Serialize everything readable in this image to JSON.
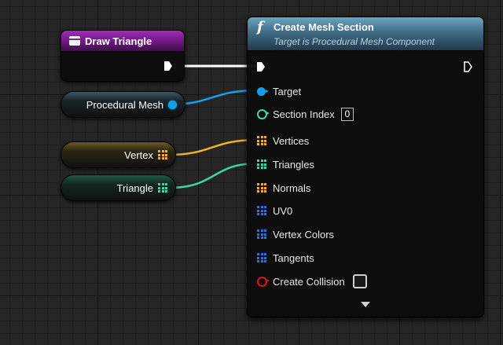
{
  "event_node": {
    "title": "Draw Triangle"
  },
  "variables": {
    "procedural_mesh": "Procedural Mesh",
    "vertex": "Vertex",
    "triangle": "Triangle"
  },
  "function_node": {
    "title": "Create Mesh Section",
    "subtitle": "Target is Procedural Mesh Component",
    "pins": {
      "target": "Target",
      "section_index": "Section Index",
      "section_index_value": "0",
      "vertices": "Vertices",
      "triangles": "Triangles",
      "normals": "Normals",
      "uv0": "UV0",
      "vertex_colors": "Vertex Colors",
      "tangents": "Tangents",
      "create_collision": "Create Collision"
    }
  },
  "colors": {
    "object_pin": "#14a0e8",
    "vector_array": "#f4b02a",
    "int_array": "#3fd6a6",
    "other_array": "#2a6ff0",
    "bool_pin": "#d61818",
    "event_header": "#8e24a8",
    "function_header": "#4f7f96"
  },
  "icons": [
    "event-icon",
    "function-icon",
    "exec-pin-icon",
    "object-pin-icon",
    "array-pin-icon",
    "expand-arrow-icon"
  ]
}
